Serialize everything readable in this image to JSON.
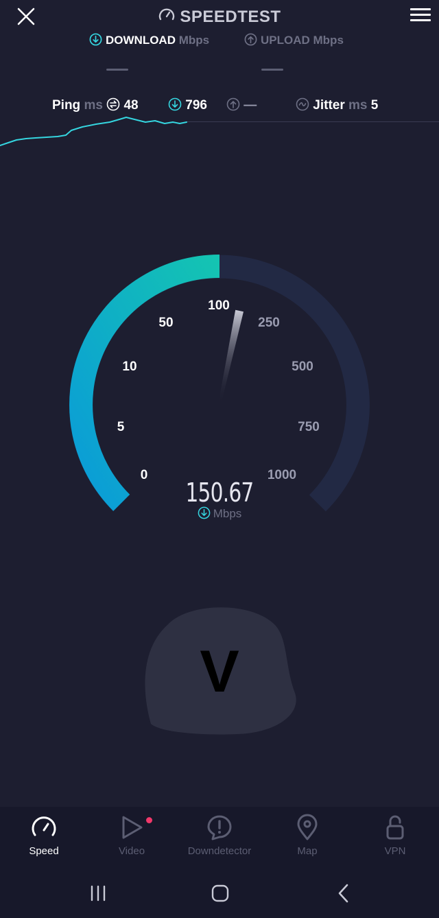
{
  "app": {
    "title": "SPEEDTEST"
  },
  "tabs": {
    "download": {
      "label": "DOWNLOAD",
      "unit": "Mbps"
    },
    "upload": {
      "label": "UPLOAD",
      "unit": "Mbps"
    }
  },
  "metrics": {
    "ping_label": "Ping",
    "ping_unit": "ms",
    "ping_value": "48",
    "download_value": "796",
    "upload_value": "—",
    "jitter_label": "Jitter",
    "jitter_unit": "ms",
    "jitter_value": "5"
  },
  "gauge": {
    "scale_labels": [
      "0",
      "5",
      "10",
      "50",
      "100",
      "250",
      "500",
      "750",
      "1000"
    ],
    "speed_value": "150.67",
    "speed_unit": "Mbps",
    "fill_fraction": 0.5
  },
  "overlay": {
    "letter": "V"
  },
  "nav": {
    "items": [
      {
        "label": "Speed",
        "icon": "speedometer-icon"
      },
      {
        "label": "Video",
        "icon": "play-icon"
      },
      {
        "label": "Downdetector",
        "icon": "alert-icon"
      },
      {
        "label": "Map",
        "icon": "map-pin-icon"
      },
      {
        "label": "VPN",
        "icon": "lock-open-icon"
      }
    ]
  },
  "colors": {
    "background": "#1d1e30",
    "accent_cyan": "#12c2b4",
    "accent_blue": "#0a9bd8",
    "notification": "#f1386a"
  }
}
